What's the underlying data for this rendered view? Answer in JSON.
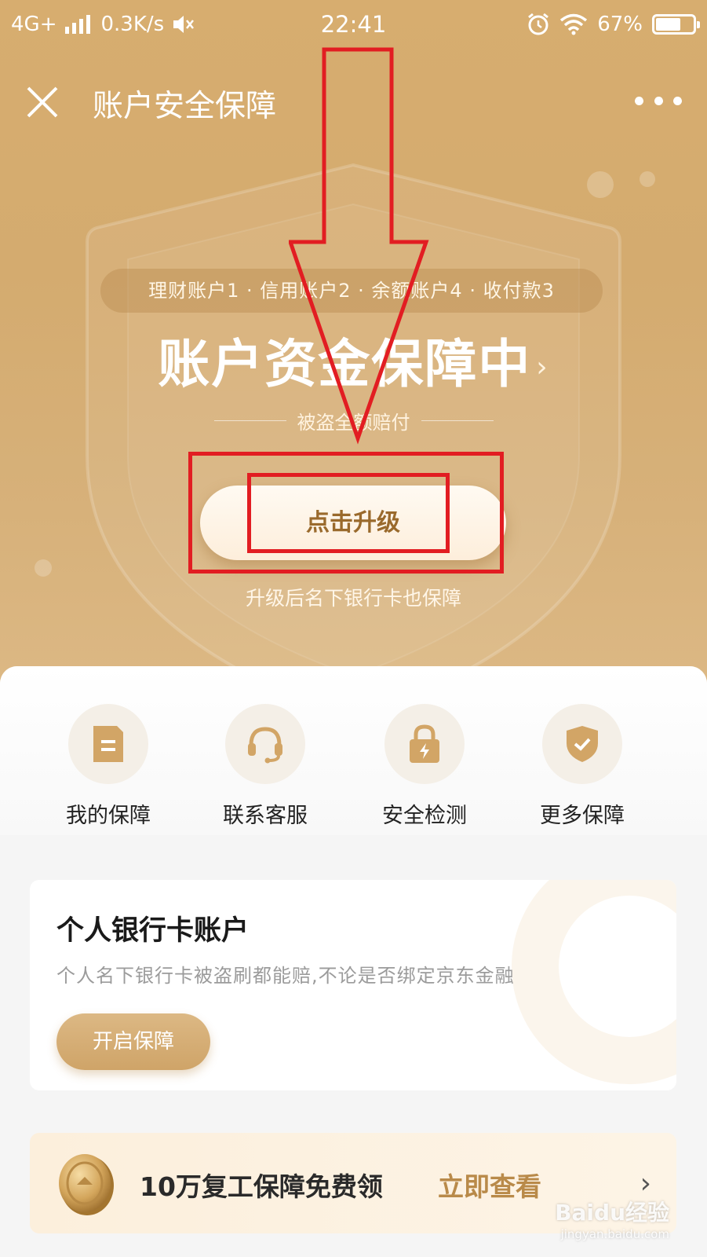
{
  "status_bar": {
    "network": "4G+",
    "speed": "0.3K/s",
    "time": "22:41",
    "battery": "67%",
    "battery_level": 0.67
  },
  "nav": {
    "title": "账户安全保障"
  },
  "hero": {
    "accounts_summary": "理财账户1 · 信用账户2 · 余额账户4 · 收付款3",
    "headline": "账户资金保障中",
    "headline_chevron": "›",
    "subline": "被盗全额赔付",
    "upgrade_button": "点击升级",
    "upgrade_note": "升级后名下银行卡也保障"
  },
  "quick_actions": [
    {
      "label": "我的保障",
      "icon": "document-icon"
    },
    {
      "label": "联系客服",
      "icon": "headset-icon"
    },
    {
      "label": "安全检测",
      "icon": "lock-bolt-icon"
    },
    {
      "label": "更多保障",
      "icon": "shield-check-icon"
    }
  ],
  "bank_card": {
    "title": "个人银行卡账户",
    "description": "个人名下银行卡被盗刷都能赔,不论是否绑定京东金融",
    "button": "开启保障"
  },
  "promo": {
    "text": "10万复工保障免费领",
    "link": "立即查看",
    "arrow": "›"
  },
  "watermark": {
    "brand": "Baidu经验",
    "url": "jingyan.baidu.com"
  },
  "colors": {
    "gold_bg": "#d7ad6f",
    "gold_text": "#9a6a2c",
    "accent": "#b98a49",
    "annotation_red": "#e21d22"
  }
}
